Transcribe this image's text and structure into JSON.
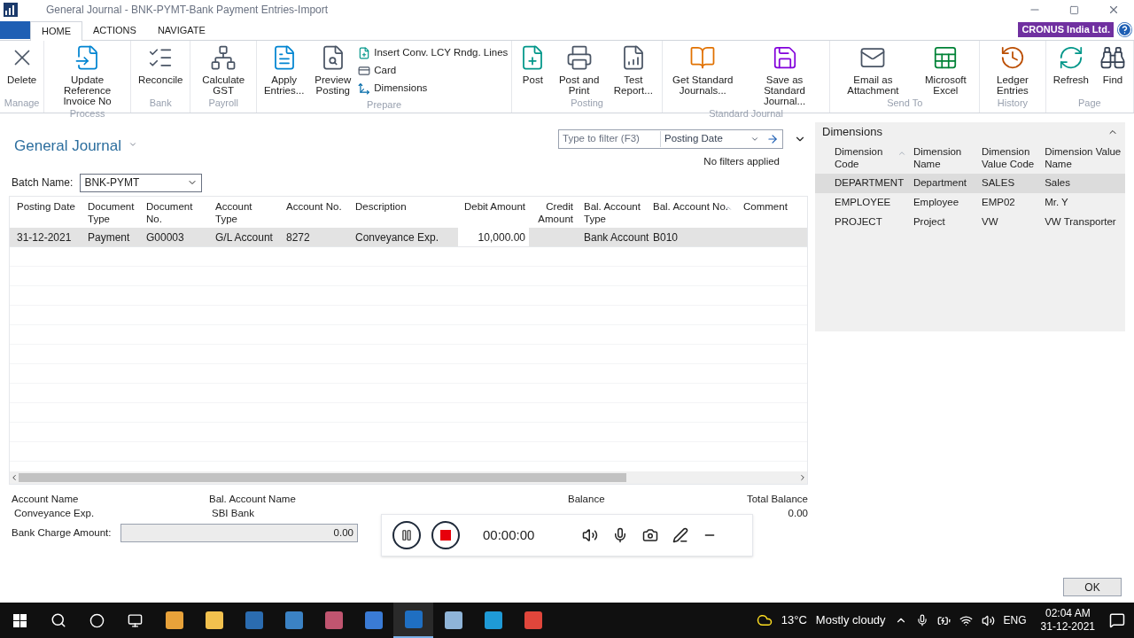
{
  "window": {
    "title": "General Journal - BNK-PYMT-Bank Payment Entries-Import"
  },
  "ribbon_tabs": [
    {
      "label": "HOME",
      "selected": true
    },
    {
      "label": "ACTIONS",
      "selected": false
    },
    {
      "label": "NAVIGATE",
      "selected": false
    }
  ],
  "company": "CRONUS India Ltd.",
  "ribbon_groups": [
    {
      "label": "Manage",
      "buttons": [
        {
          "label": "Delete",
          "kind": "large"
        }
      ]
    },
    {
      "label": "Process",
      "buttons": [
        {
          "label": "Update Reference Invoice No",
          "kind": "large"
        }
      ]
    },
    {
      "label": "Bank",
      "buttons": [
        {
          "label": "Reconcile",
          "kind": "large"
        }
      ]
    },
    {
      "label": "Payroll",
      "buttons": [
        {
          "label": "Calculate GST",
          "kind": "large"
        }
      ]
    },
    {
      "label": "Prepare",
      "buttons": [
        {
          "label": "Apply Entries...",
          "kind": "large"
        },
        {
          "label": "Preview Posting",
          "kind": "large"
        },
        {
          "label": "Insert Conv. LCY Rndg. Lines",
          "kind": "small"
        },
        {
          "label": "Card",
          "kind": "small"
        },
        {
          "label": "Dimensions",
          "kind": "small"
        }
      ]
    },
    {
      "label": "Posting",
      "buttons": [
        {
          "label": "Post",
          "kind": "large"
        },
        {
          "label": "Post and Print",
          "kind": "large"
        },
        {
          "label": "Test Report...",
          "kind": "large"
        }
      ]
    },
    {
      "label": "Standard Journal",
      "buttons": [
        {
          "label": "Get Standard Journals...",
          "kind": "large"
        },
        {
          "label": "Save as Standard Journal...",
          "kind": "large"
        }
      ]
    },
    {
      "label": "Send To",
      "buttons": [
        {
          "label": "Email as Attachment",
          "kind": "large"
        },
        {
          "label": "Microsoft Excel",
          "kind": "large"
        }
      ]
    },
    {
      "label": "History",
      "buttons": [
        {
          "label": "Ledger Entries",
          "kind": "large"
        }
      ]
    },
    {
      "label": "Page",
      "buttons": [
        {
          "label": "Refresh",
          "kind": "large"
        },
        {
          "label": "Find",
          "kind": "large"
        }
      ]
    }
  ],
  "page": {
    "title": "General Journal",
    "filter": {
      "placeholder": "Type to filter (F3)",
      "field": "Posting Date"
    },
    "filter_status": "No filters applied",
    "batch": {
      "label": "Batch Name:",
      "value": "BNK-PYMT"
    }
  },
  "journal": {
    "columns": [
      {
        "label": "Posting Date",
        "kind": "text",
        "sorted": false
      },
      {
        "label": "Document Type",
        "kind": "text",
        "sorted": false
      },
      {
        "label": "Document No.",
        "kind": "text",
        "sorted": false
      },
      {
        "label": "Account Type",
        "kind": "text",
        "sorted": false
      },
      {
        "label": "Account No.",
        "kind": "text",
        "sorted": false
      },
      {
        "label": "Description",
        "kind": "text",
        "sorted": false
      },
      {
        "label": "Debit Amount",
        "kind": "amount",
        "sorted": false
      },
      {
        "label": "Credit Amount",
        "kind": "amount",
        "sorted": false
      },
      {
        "label": "Bal. Account Type",
        "kind": "text",
        "sorted": false
      },
      {
        "label": "Bal. Account No.",
        "kind": "text",
        "sorted": true
      },
      {
        "label": "Comment",
        "kind": "text",
        "sorted": false
      }
    ],
    "rows": [
      {
        "selected": true,
        "cells": [
          "31-12-2021",
          "Payment",
          "G00003",
          "G/L Account",
          "8272",
          "Conveyance Exp.",
          "10,000.00",
          "",
          "Bank Account",
          "B010",
          ""
        ]
      }
    ]
  },
  "totals": {
    "account_name": {
      "label": "Account Name",
      "value": "Conveyance Exp."
    },
    "bal_account_name": {
      "label": "Bal. Account Name",
      "value": "SBI Bank"
    },
    "balance": {
      "label": "Balance"
    },
    "total_balance": {
      "label": "Total Balance",
      "value": "0.00"
    },
    "bank_charge": {
      "label": "Bank Charge Amount:",
      "value": "0.00"
    }
  },
  "dimensions": {
    "title": "Dimensions",
    "expanded": true,
    "columns": [
      {
        "label": "Dimension Code",
        "sorted": true
      },
      {
        "label": "Dimension Name",
        "sorted": false
      },
      {
        "label": "Dimension Value Code",
        "sorted": false
      },
      {
        "label": "Dimension Value Name",
        "sorted": false
      }
    ],
    "rows": [
      {
        "selected": true,
        "cells": [
          "DEPARTMENT",
          "Department",
          "SALES",
          "Sales"
        ]
      },
      {
        "selected": false,
        "cells": [
          "EMPLOYEE",
          "Employee",
          "EMP02",
          "Mr. Y"
        ]
      },
      {
        "selected": false,
        "cells": [
          "PROJECT",
          "Project",
          "VW",
          "VW Transporter"
        ]
      }
    ]
  },
  "recorder": {
    "time": "00:00:00"
  },
  "ok_button": "OK",
  "taskbar": {
    "temperature": "13°C",
    "weather": "Mostly cloudy",
    "language": "ENG",
    "time": "02:04 AM",
    "date": "31-12-2021"
  }
}
